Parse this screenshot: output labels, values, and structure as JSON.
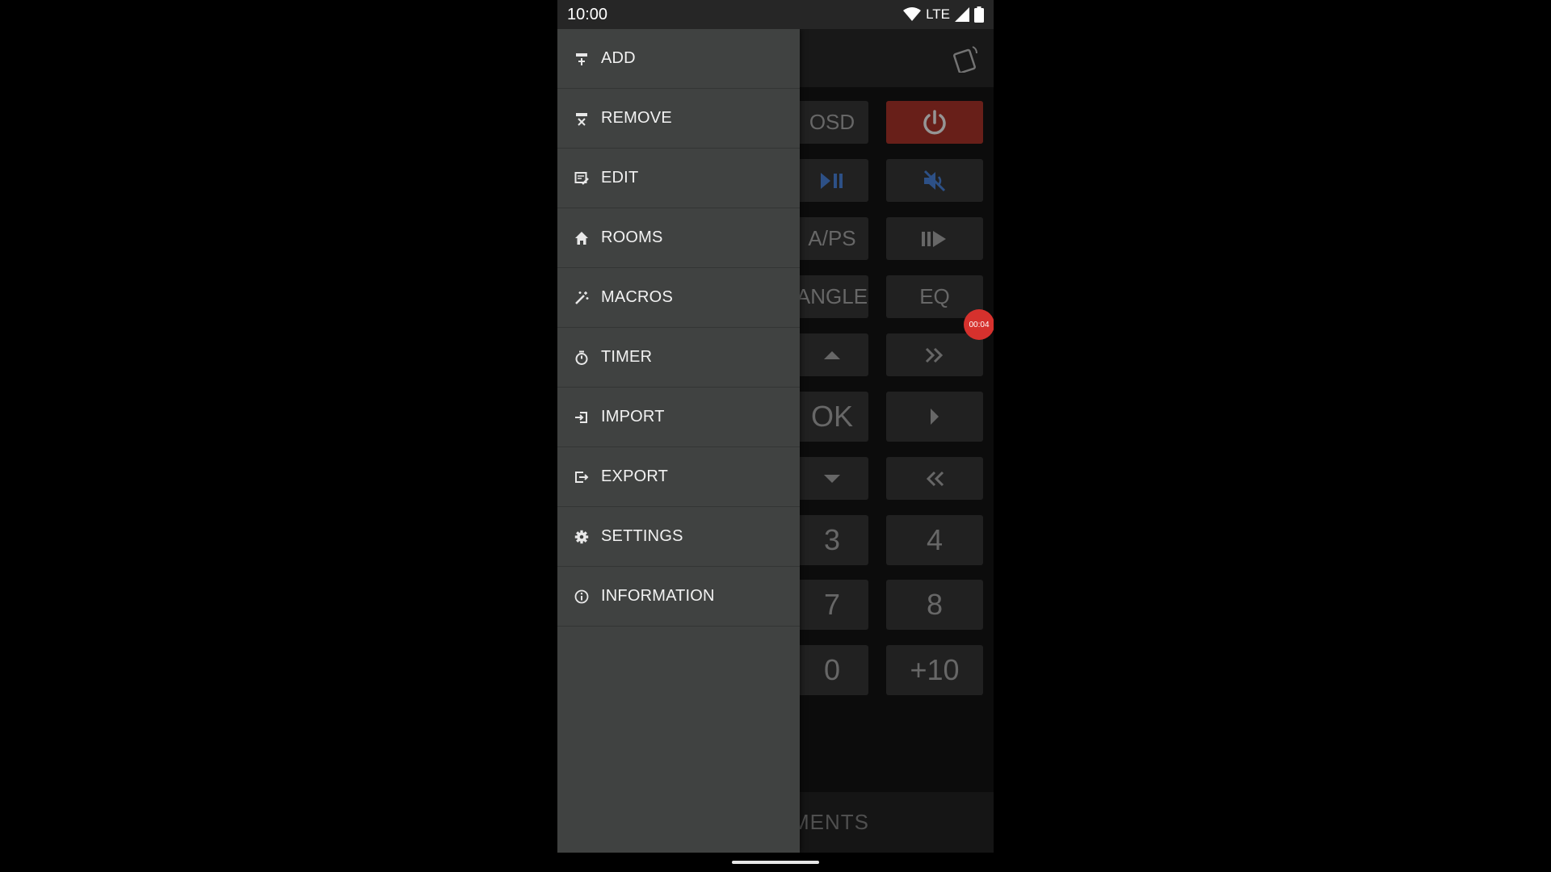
{
  "status": {
    "time": "10:00",
    "network": "LTE"
  },
  "drawer": {
    "items": [
      {
        "label": "ADD",
        "icon": "add-remote-icon"
      },
      {
        "label": "REMOVE",
        "icon": "remove-remote-icon"
      },
      {
        "label": "EDIT",
        "icon": "edit-remote-icon"
      },
      {
        "label": "ROOMS",
        "icon": "home-icon"
      },
      {
        "label": "MACROS",
        "icon": "magic-wand-icon"
      },
      {
        "label": "TIMER",
        "icon": "stopwatch-icon"
      },
      {
        "label": "IMPORT",
        "icon": "import-icon"
      },
      {
        "label": "EXPORT",
        "icon": "export-icon"
      },
      {
        "label": "SETTINGS",
        "icon": "gear-icon"
      },
      {
        "label": "INFORMATION",
        "icon": "info-icon"
      }
    ]
  },
  "remote": {
    "osd": "OSD",
    "aps": "A/PS",
    "angle": "ANGLE",
    "eq": "EQ",
    "ok": "OK",
    "n3": "3",
    "n4": "4",
    "n7": "7",
    "n8": "8",
    "n0": "0",
    "plus10": "+10",
    "bottom_tab": "MENTS"
  },
  "recording_badge": "00:04",
  "colors": {
    "power": "#8b2a22",
    "accent_blue": "#3d6bb3",
    "record": "#d6312d",
    "drawer": "#404241"
  }
}
